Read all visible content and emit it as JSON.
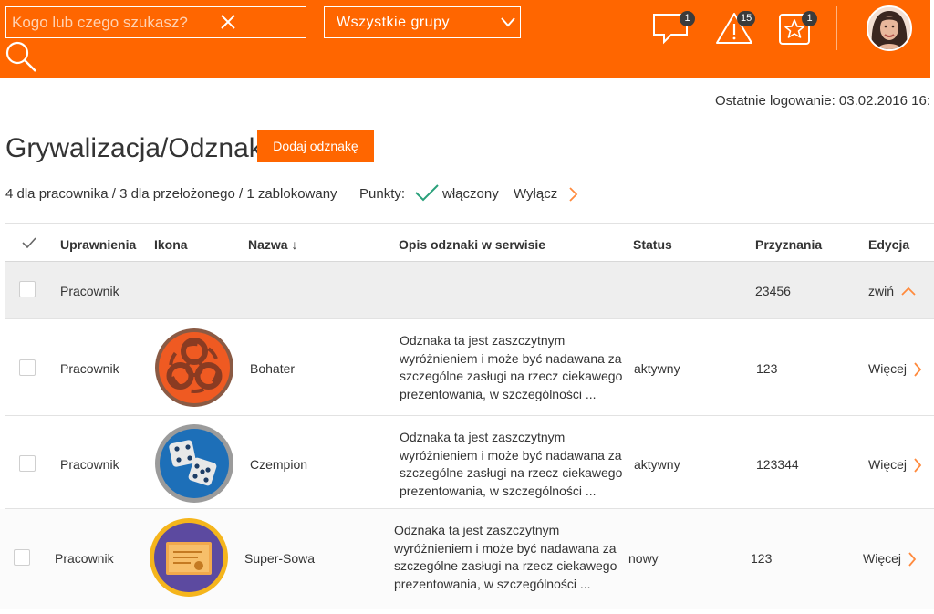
{
  "header": {
    "search_placeholder": "Kogo lub czego szukasz?",
    "group_select": "Wszystkie grupy",
    "messages_count": "1",
    "alerts_count": "15",
    "favorites_count": "1"
  },
  "last_login": "Ostatnie logowanie: 03.02.2016 16:",
  "page": {
    "title": "Grywalizacja/Odznaki",
    "add_button": "Dodaj odznakę",
    "summary": "4 dla pracownika / 3 dla przełożonego / 1 zablokowany",
    "points_label": "Punkty:",
    "points_status": "włączony",
    "points_toggle": "Wyłącz"
  },
  "table": {
    "columns": [
      "Uprawnienia",
      "Ikona",
      "Nazwa ↓",
      "Opis odznaki w serwisie",
      "Status",
      "Przyznania",
      "Edycja"
    ],
    "group_row": {
      "role": "Pracownik",
      "grants": "23456",
      "action": "zwiń"
    },
    "rows": [
      {
        "role": "Pracownik",
        "icon": "biohazard-badge-icon",
        "name": "Bohater",
        "desc": "Odznaka ta jest zaszczytnym wyróżnieniem i może być nadawana za szczególne zasługi na rzecz ciekawego prezentowania, w szczególności ...",
        "status": "aktywny",
        "grants": "123",
        "action": "Więcej"
      },
      {
        "role": "Pracownik",
        "icon": "dice-badge-icon",
        "name": "Czempion",
        "desc": "Odznaka ta jest zaszczytnym wyróżnieniem i może być nadawana za szczególne zasługi na rzecz ciekawego prezentowania, w szczególności ...",
        "status": "aktywny",
        "grants": "123344",
        "action": "Więcej"
      },
      {
        "role": "Pracownik",
        "icon": "certificate-badge-icon",
        "name": "Super-Sowa",
        "desc": "Odznaka ta jest zaszczytnym wyróżnieniem i może być nadawana za szczególne zasługi na rzecz ciekawego prezentowania, w szczególności ...",
        "status": "nowy",
        "grants": "123",
        "action": "Więcej"
      }
    ]
  },
  "colors": {
    "brand": "#ff6600",
    "check": "#2aa07a"
  }
}
